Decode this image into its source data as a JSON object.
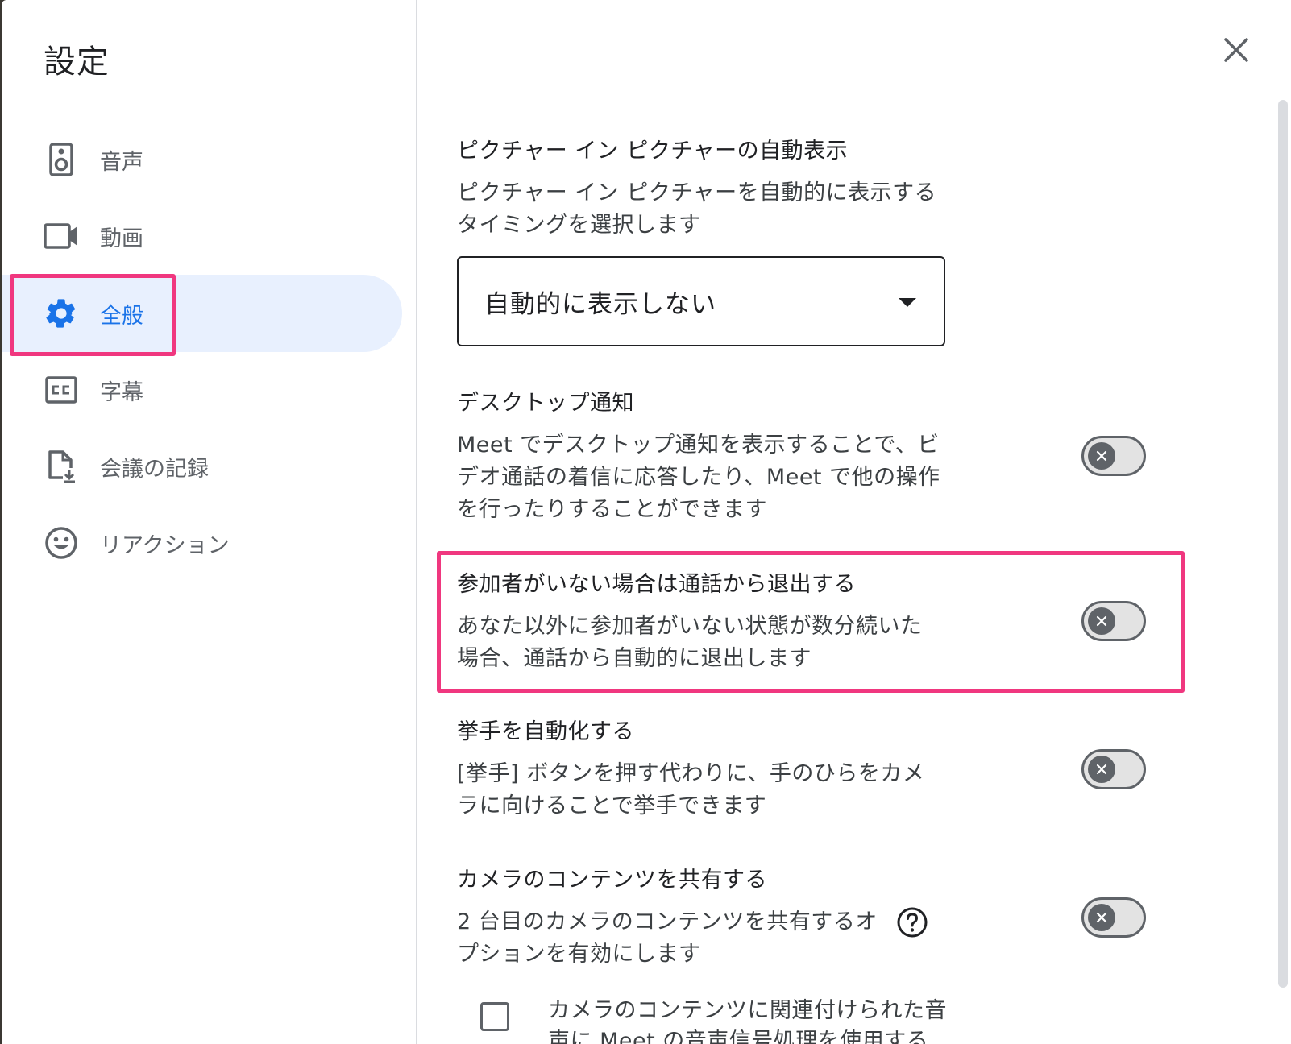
{
  "dialog": {
    "title": "設定",
    "close_icon": "close-icon"
  },
  "sidebar": {
    "items": [
      {
        "label": "音声",
        "icon": "speaker-icon",
        "active": false
      },
      {
        "label": "動画",
        "icon": "videocam-icon",
        "active": false
      },
      {
        "label": "全般",
        "icon": "gear-icon",
        "active": true
      },
      {
        "label": "字幕",
        "icon": "closed-caption-icon",
        "active": false
      },
      {
        "label": "会議の記録",
        "icon": "file-download-icon",
        "active": false
      },
      {
        "label": "リアクション",
        "icon": "smiley-icon",
        "active": false
      }
    ]
  },
  "settings": {
    "pip": {
      "title": "ピクチャー イン ピクチャーの自動表示",
      "desc_line1": "ピクチャー イン ピクチャーを自動的に表示する",
      "desc_line2": "タイミングを選択します",
      "selected": "自動的に表示しない"
    },
    "desktop_notify": {
      "title": "デスクトップ通知",
      "desc_line1": "Meet でデスクトップ通知を表示することで、ビ",
      "desc_line2": "デオ通話の着信に応答したり、Meet で他の操作",
      "desc_line3": "を行ったりすることができます",
      "enabled": false
    },
    "leave_empty_call": {
      "title": "参加者がいない場合は通話から退出する",
      "desc_line1": "あなた以外に参加者がいない状態が数分続いた",
      "desc_line2": "場合、通話から自動的に退出します",
      "enabled": false
    },
    "auto_raise_hand": {
      "title": "挙手を自動化する",
      "desc_line1": "[挙手] ボタンを押す代わりに、手のひらをカメ",
      "desc_line2": "ラに向けることで挙手できます",
      "enabled": false
    },
    "share_camera": {
      "title": "カメラのコンテンツを共有する",
      "desc_line1": "2 台目のカメラのコンテンツを共有するオ",
      "desc_line2": "プションを有効にします",
      "enabled": false,
      "help_icon": "help-icon",
      "checkbox_line1": "カメラのコンテンツに関連付けられた音",
      "checkbox_line2": "声に Meet の音声信号処理を使用する",
      "checkbox_checked": false
    }
  },
  "colors": {
    "accent": "#1a73e8",
    "active_bg": "#e8f0fe",
    "highlight": "#f0377f",
    "toggle_off": "#5f6368"
  }
}
